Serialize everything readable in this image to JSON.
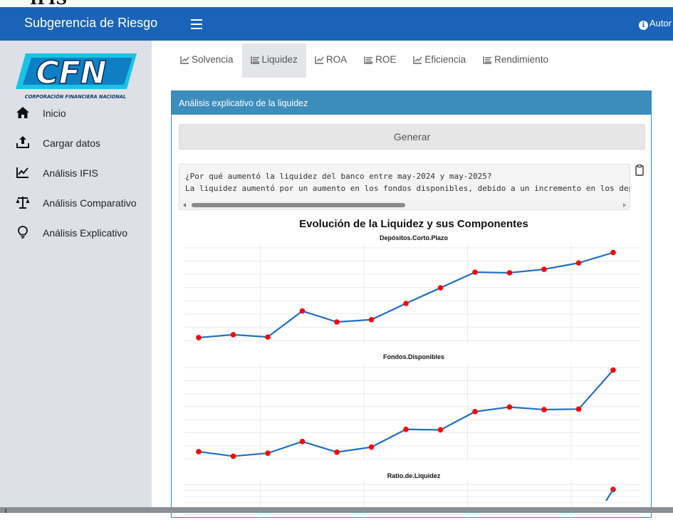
{
  "top_strip_text": "IFIS",
  "header": {
    "title": "Subgerencia de Riesgo",
    "author_label": "Autor"
  },
  "logo": {
    "text": "CFN",
    "subtitle": "CORPORACIÓN FINANCIERA NACIONAL"
  },
  "sidebar": {
    "items": [
      {
        "label": "Inicio",
        "icon": "home-icon"
      },
      {
        "label": "Cargar datos",
        "icon": "upload-icon"
      },
      {
        "label": "Análisis IFIS",
        "icon": "line-chart-icon"
      },
      {
        "label": "Análisis Comparativo",
        "icon": "balance-scale-icon"
      },
      {
        "label": "Análisis Explicativo",
        "icon": "lightbulb-icon"
      }
    ]
  },
  "tabs": [
    {
      "label": "Solvencia",
      "icon": "line-chart-icon",
      "active": false
    },
    {
      "label": "Liquidez",
      "icon": "bar-list-icon",
      "active": true
    },
    {
      "label": "ROA",
      "icon": "line-chart-icon",
      "active": false
    },
    {
      "label": "ROE",
      "icon": "bar-list-icon",
      "active": false
    },
    {
      "label": "Eficiencia",
      "icon": "line-chart-icon",
      "active": false
    },
    {
      "label": "Rendimiento",
      "icon": "bar-list-icon",
      "active": false
    }
  ],
  "card": {
    "title": "Análisis explicativo de la liquidez",
    "generate_label": "Generar",
    "output_lines": [
      "¿Por qué aumentó la liquidez del banco entre may-2024 y may-2025?",
      "La liquidez aumentó por un aumento en los fondos disponibles, debido a un incremento en los dep"
    ]
  },
  "colors": {
    "header_bg": "#1a63b8",
    "card_header_bg": "#3c8dbc",
    "line_color": "#1f6fc6",
    "point_color": "#ff0000"
  },
  "chart_data": {
    "type": "line",
    "title": "Evolución de la Liquidez y sus Componentes",
    "point_count": 13,
    "panels": [
      {
        "name": "Depósitos.Corto.Plazo",
        "values": [
          0.0,
          0.5,
          0.1,
          4.6,
          2.7,
          3.1,
          5.9,
          8.6,
          11.3,
          11.2,
          11.8,
          12.9,
          14.7
        ],
        "ylim": [
          -0.5,
          15.5
        ]
      },
      {
        "name": "Fondos.Disponibles",
        "values": [
          0.9,
          0.0,
          0.6,
          2.9,
          0.8,
          1.8,
          5.3,
          5.2,
          8.8,
          9.7,
          9.2,
          9.3,
          17.0
        ],
        "ylim": [
          -0.5,
          17.5
        ]
      },
      {
        "name": "Ratio.de.Liquidez",
        "values": [
          null,
          null,
          null,
          null,
          null,
          null,
          null,
          null,
          null,
          null,
          null,
          null,
          3.0
        ],
        "ylim": [
          0,
          3.4
        ]
      }
    ],
    "grid": true
  }
}
